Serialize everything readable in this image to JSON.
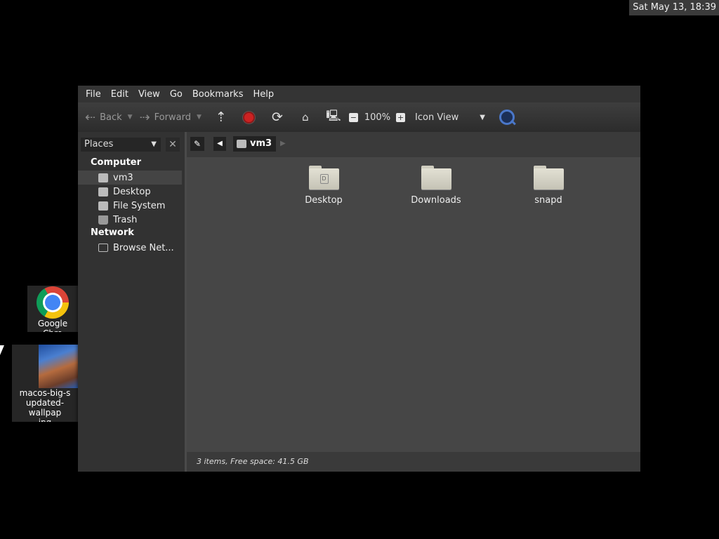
{
  "clock": "Sat May 13, 18:39",
  "desktop": {
    "chrome_label": "Google Chro",
    "wallpaper_label": "macos-big-s\nupdated-wallpap\njpg"
  },
  "menu": [
    "File",
    "Edit",
    "View",
    "Go",
    "Bookmarks",
    "Help"
  ],
  "toolbar": {
    "back": "Back",
    "forward": "Forward",
    "zoom": "100%",
    "view_mode": "Icon View"
  },
  "sidebar": {
    "places_label": "Places",
    "sections": {
      "computer": "Computer",
      "network": "Network"
    },
    "items": [
      "vm3",
      "Desktop",
      "File System",
      "Trash",
      "Browse Net..."
    ]
  },
  "location": {
    "current": "vm3"
  },
  "files": [
    {
      "name": "Desktop"
    },
    {
      "name": "Downloads"
    },
    {
      "name": "snapd"
    }
  ],
  "status": "3 items, Free space: 41.5 GB",
  "colors": {
    "window_bg": "#2f2f2f",
    "content_bg": "#464646",
    "selection": "#444444",
    "stop_red": "#cc2222"
  }
}
